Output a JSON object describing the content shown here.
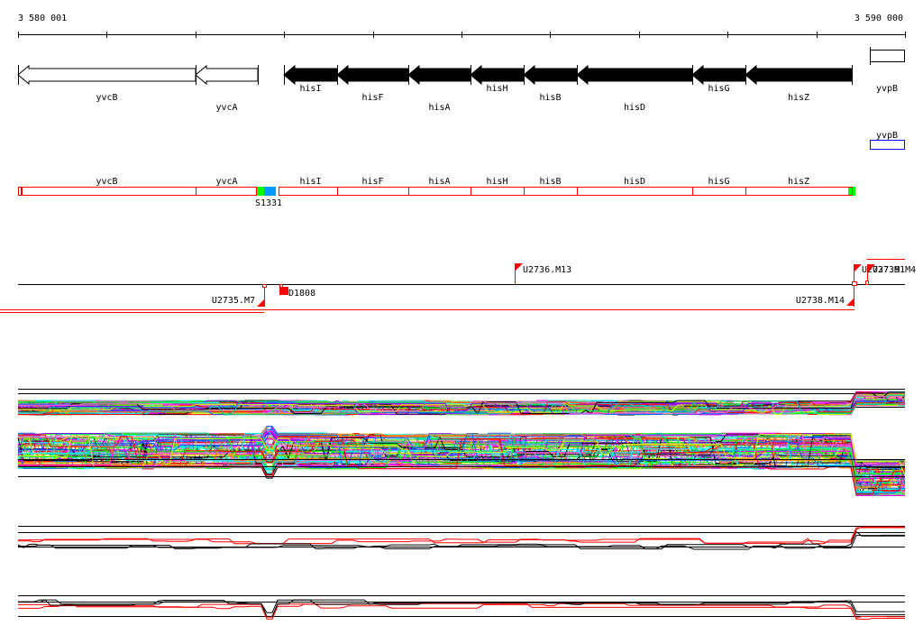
{
  "axis": {
    "start_label": "3 580 001",
    "end_label": "3 590 000"
  },
  "genes": [
    {
      "name": "yvcB",
      "start": 3580001,
      "end": 3582000,
      "filled": false
    },
    {
      "name": "yvcA",
      "start": 3582000,
      "end": 3582700,
      "filled": false
    },
    {
      "name": "hisI",
      "start": 3583000,
      "end": 3583600,
      "filled": true
    },
    {
      "name": "hisF",
      "start": 3583600,
      "end": 3584400,
      "filled": true
    },
    {
      "name": "hisA",
      "start": 3584400,
      "end": 3585100,
      "filled": true
    },
    {
      "name": "hisH",
      "start": 3585100,
      "end": 3585700,
      "filled": true
    },
    {
      "name": "hisB",
      "start": 3585700,
      "end": 3586300,
      "filled": true
    },
    {
      "name": "hisD",
      "start": 3586300,
      "end": 3587600,
      "filled": true
    },
    {
      "name": "hisG",
      "start": 3587600,
      "end": 3588200,
      "filled": true
    },
    {
      "name": "hisZ",
      "start": 3588200,
      "end": 3589400,
      "filled": true
    },
    {
      "name": "yvpB",
      "start": 3589600,
      "end": 3590000,
      "filled": false
    }
  ],
  "other_strand": {
    "label": "yvpB"
  },
  "segment_label": "S1331",
  "transcription": {
    "above": [
      "U2736.M13",
      "U2737.M1",
      "U2739.M4"
    ],
    "below": [
      "U2735.M7",
      "D1808",
      "U2738.M14"
    ]
  },
  "colors": {
    "accent": "#ff0000",
    "blue": "#0000ff",
    "green": "#00ff00",
    "sky": "#0099ff"
  }
}
